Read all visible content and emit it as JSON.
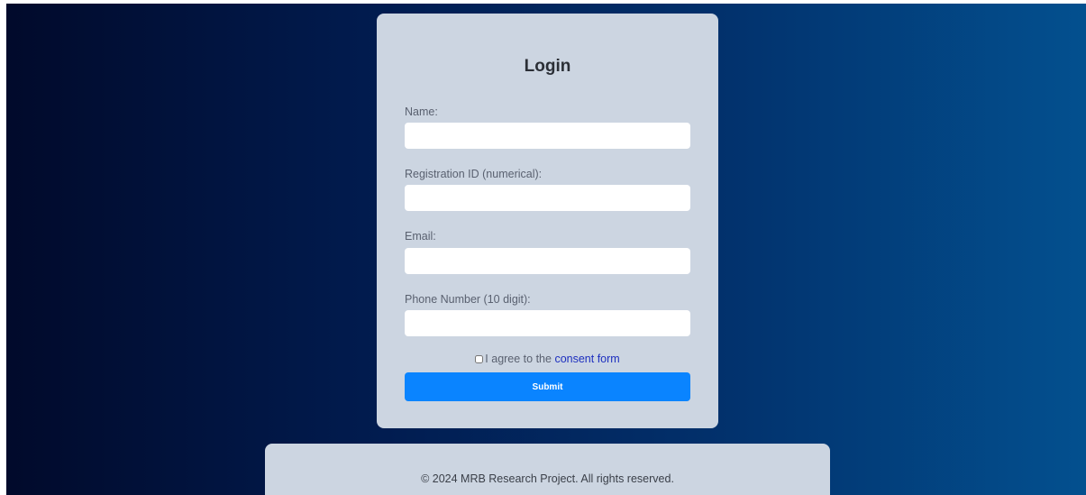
{
  "login": {
    "title": "Login",
    "fields": [
      {
        "label": "Name:",
        "value": "",
        "placeholder": ""
      },
      {
        "label": "Registration ID (numerical):",
        "value": "",
        "placeholder": ""
      },
      {
        "label": "Email:",
        "value": "",
        "placeholder": ""
      },
      {
        "label": "Phone Number (10 digit):",
        "value": "",
        "placeholder": ""
      }
    ],
    "consent_prefix": "I agree to the ",
    "consent_link": "consent form",
    "submit_label": "Submit"
  },
  "footer": {
    "text": "© 2024 MRB Research Project. All rights reserved."
  },
  "colors": {
    "card_background": "#ccd5e1",
    "submit_button": "#0a84ff",
    "link": "#1d2fbf",
    "background_left": "#010a2b",
    "background_right": "#03508f"
  }
}
